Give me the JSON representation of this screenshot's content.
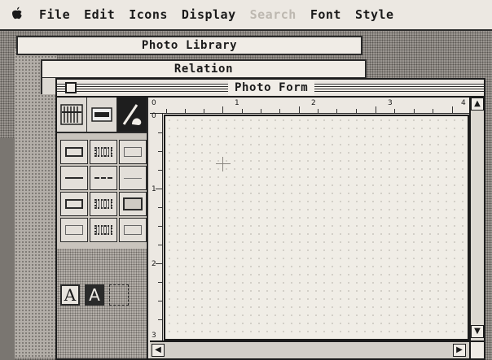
{
  "menubar": {
    "apple_icon": "apple-icon",
    "items": [
      {
        "label": "File",
        "enabled": true
      },
      {
        "label": "Edit",
        "enabled": true
      },
      {
        "label": "Icons",
        "enabled": true
      },
      {
        "label": "Display",
        "enabled": true
      },
      {
        "label": "Search",
        "enabled": false
      },
      {
        "label": "Font",
        "enabled": true
      },
      {
        "label": "Style",
        "enabled": true
      }
    ]
  },
  "windows": {
    "photo_library": {
      "title": "Photo Library"
    },
    "relation": {
      "title": "Relation"
    },
    "photo_form": {
      "title": "Photo Form"
    }
  },
  "ruler": {
    "horizontal_labels": [
      "0",
      "1",
      "2",
      "3",
      "4"
    ],
    "vertical_labels": [
      "0",
      "1",
      "2",
      "3"
    ]
  },
  "palette": {
    "tools": [
      "lines-tool-icon",
      "field-tool-icon",
      "pen-tool-icon"
    ],
    "font_buttons": [
      "A",
      "A"
    ]
  }
}
